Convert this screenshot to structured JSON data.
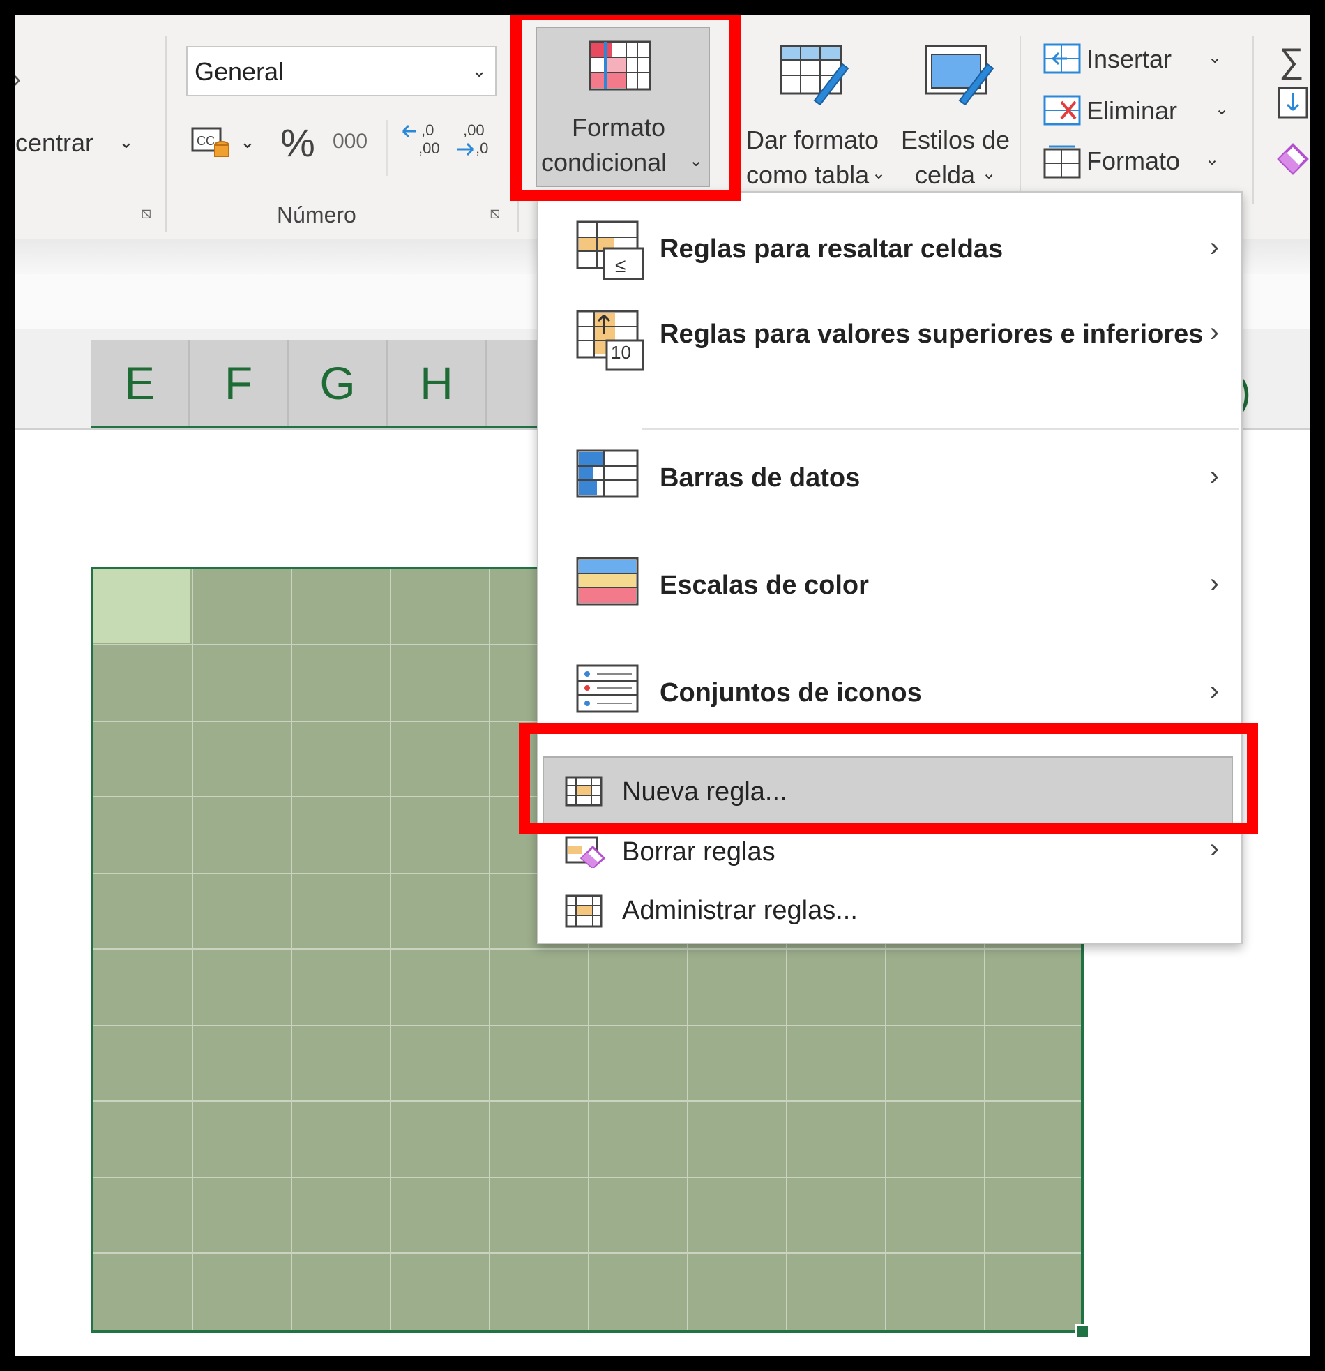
{
  "ribbon": {
    "partial_label": "centrar",
    "number_format": {
      "value": "General"
    },
    "percent_symbol": "%",
    "thousands_symbol": "000",
    "increase_decimal": "←0 ,00",
    "decrease_decimal": ",00 →,0",
    "group_number_label": "Número",
    "conditional_format": {
      "line1": "Formato",
      "line2": "condicional"
    },
    "format_table": {
      "line1": "Dar formato",
      "line2": "como tabla"
    },
    "cell_styles": {
      "line1": "Estilos de",
      "line2": "celda"
    },
    "cells_group": {
      "insert": "Insertar",
      "delete": "Eliminar",
      "format": "Formato"
    },
    "sum_symbol": "∑"
  },
  "sheet": {
    "columns": [
      "E",
      "F",
      "G",
      "H"
    ],
    "selection_fill": "#9cae8c",
    "active_cell_fill": "#c6dbb4"
  },
  "menu": {
    "highlight_cells_rules": "Reglas para resaltar celdas",
    "top_bottom_rules": "Reglas para valores superiores e inferiores",
    "top_bottom_icon_value": "10",
    "data_bars": "Barras de datos",
    "color_scales": "Escalas de color",
    "icon_sets": "Conjuntos de iconos",
    "new_rule": "Nueva regla...",
    "clear_rules": "Borrar reglas",
    "manage_rules": "Administrar reglas..."
  },
  "annotation_color": "#ff0000"
}
